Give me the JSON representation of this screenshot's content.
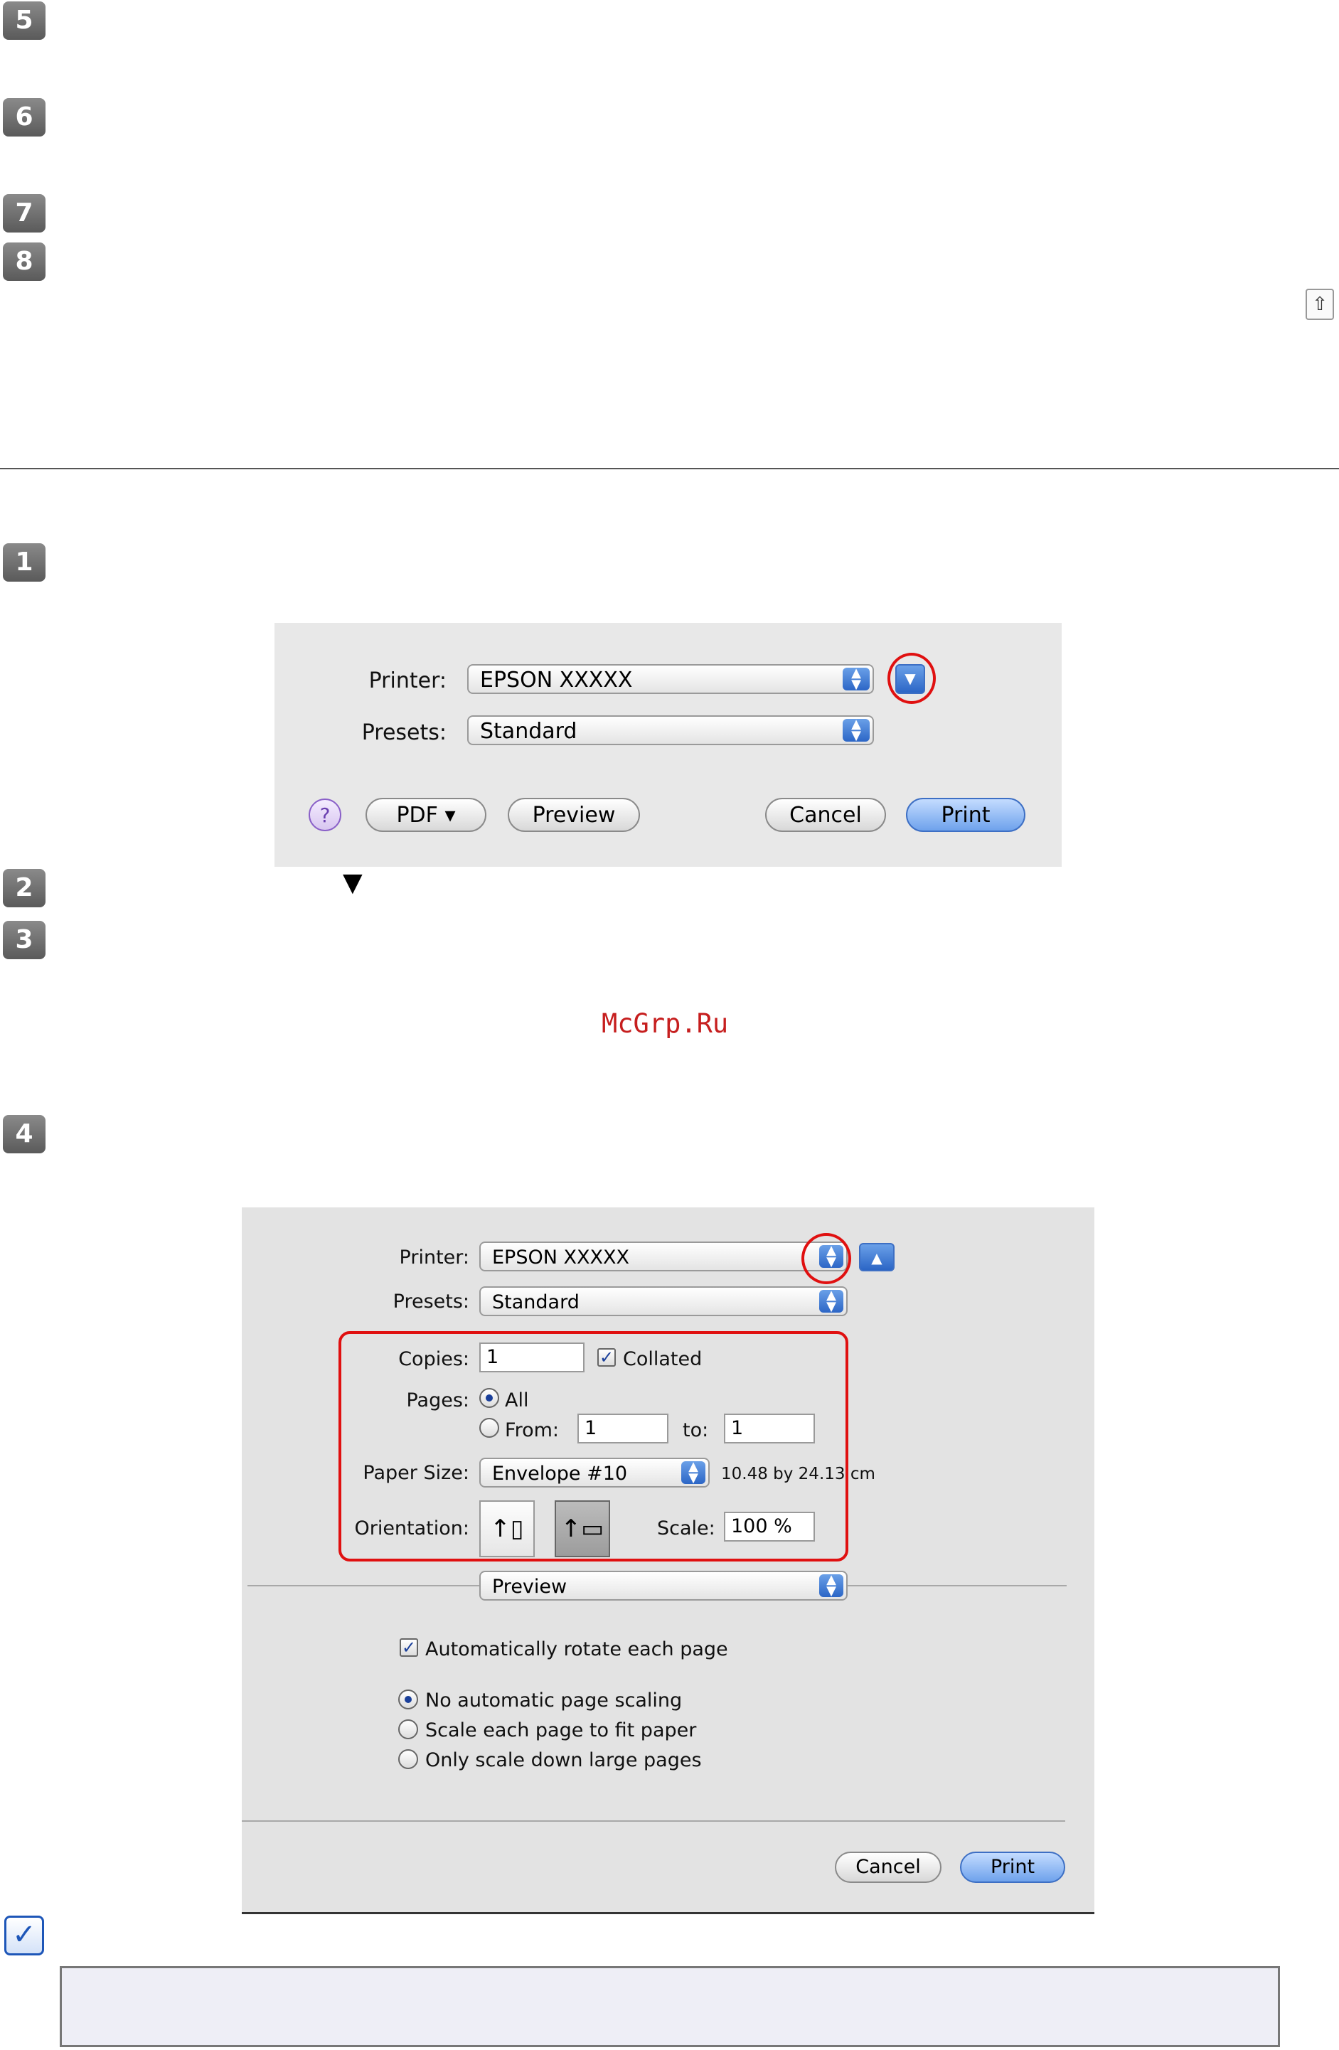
{
  "steps": {
    "s5": "5",
    "s6": "6",
    "s7": "7",
    "s8": "8",
    "s1": "1",
    "s2": "2",
    "s3": "3",
    "s4": "4"
  },
  "top_icon": "up-arrow-icon",
  "watermark": "McGrp.Ru",
  "inline_glyph": "▼",
  "dialog1": {
    "printer_label": "Printer:",
    "printer_value": "EPSON XXXXX",
    "presets_label": "Presets:",
    "presets_value": "Standard",
    "expand_glyph": "▼",
    "help_glyph": "?",
    "pdf_label": "PDF ▾",
    "preview_label": "Preview",
    "cancel_label": "Cancel",
    "print_label": "Print"
  },
  "dialog2": {
    "printer_label": "Printer:",
    "printer_value": "EPSON XXXXX",
    "collapse_glyph": "▲",
    "presets_label": "Presets:",
    "presets_value": "Standard",
    "copies_label": "Copies:",
    "copies_value": "1",
    "collated_label": "Collated",
    "collated_checked": true,
    "pages_label": "Pages:",
    "pages_all": "All",
    "pages_from": "From:",
    "from_value": "1",
    "to_label": "to:",
    "to_value": "1",
    "paper_size_label": "Paper Size:",
    "paper_size_value": "Envelope #10",
    "paper_dims": "10.48 by 24.13 cm",
    "orientation_label": "Orientation:",
    "scale_label": "Scale:",
    "scale_value": "100 %",
    "section_value": "Preview",
    "auto_rotate": "Automatically rotate each page",
    "opt_no_scaling": "No automatic page scaling",
    "opt_fit": "Scale each page to fit paper",
    "opt_scale_down": "Only scale down large pages",
    "cancel_label": "Cancel",
    "print_label": "Print"
  },
  "colors": {
    "highlight": "#e01010",
    "accent": "#2c66c6",
    "note_bg": "#eeeef6"
  },
  "note_icon": "checkmark-note-icon"
}
